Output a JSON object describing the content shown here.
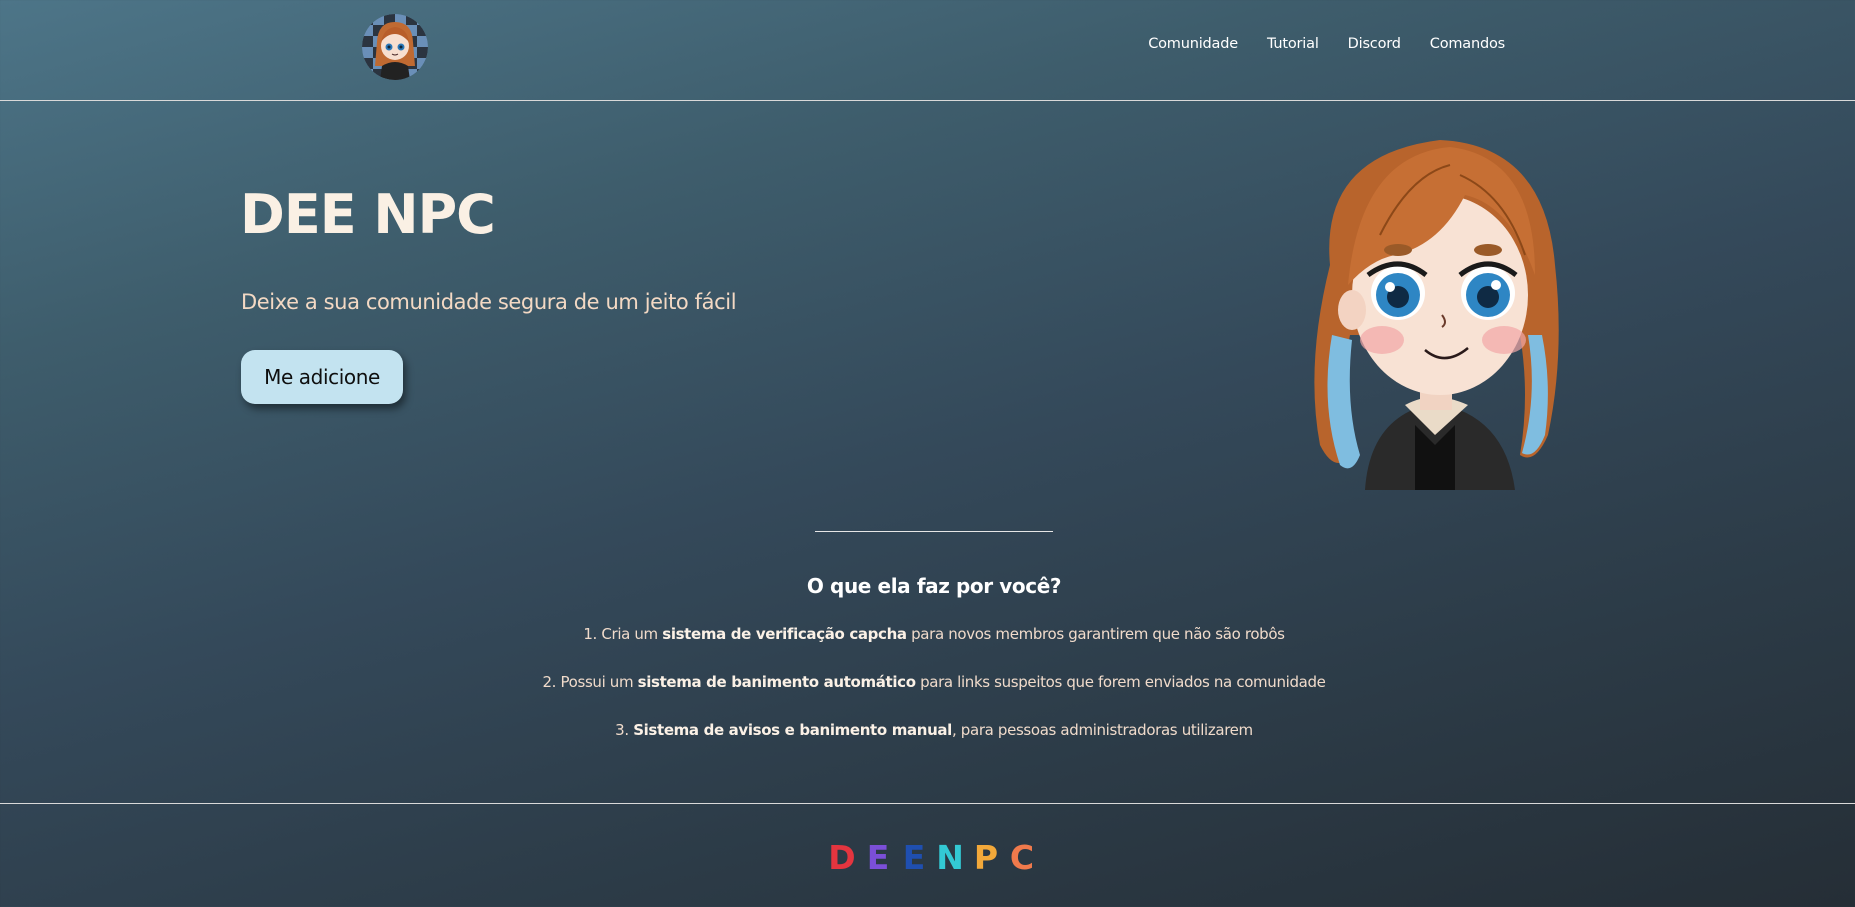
{
  "header": {
    "logo_icon": "character-avatar-icon",
    "nav": [
      {
        "label": "Comunidade"
      },
      {
        "label": "Tutorial"
      },
      {
        "label": "Discord"
      },
      {
        "label": "Comandos"
      }
    ]
  },
  "hero": {
    "title": "DEE NPC",
    "subtitle": "Deixe a sua comunidade segura de um jeito fácil",
    "cta_label": "Me adicione",
    "illustration_icon": "chibi-character-illustration"
  },
  "features": {
    "heading": "O que ela faz por você?",
    "items": [
      {
        "prefix": "1. Cria um ",
        "bold": "sistema de verificação capcha",
        "suffix": " para novos membros garantirem que não são robôs"
      },
      {
        "prefix": "2. Possui um ",
        "bold": "sistema de banimento automático",
        "suffix": " para links suspeitos que forem enviados na comunidade"
      },
      {
        "prefix": "3. ",
        "bold": "Sistema de avisos e banimento manual",
        "suffix": ", para pessoas administradoras utilizarem"
      }
    ]
  },
  "footer": {
    "logo_letters": [
      {
        "char": "D",
        "color": "#e4353f"
      },
      {
        "char": "E",
        "color": "#7b4fd8"
      },
      {
        "char": "E",
        "color": "#1f4fb0"
      },
      {
        "char": "N",
        "color": "#33c9d4"
      },
      {
        "char": "P",
        "color": "#f3a93a"
      },
      {
        "char": "C",
        "color": "#f07a4c"
      }
    ]
  },
  "colors": {
    "cta_background": "#c3e3f0",
    "title_text": "#faf0e4",
    "subtitle_text": "#f3d9c4"
  }
}
